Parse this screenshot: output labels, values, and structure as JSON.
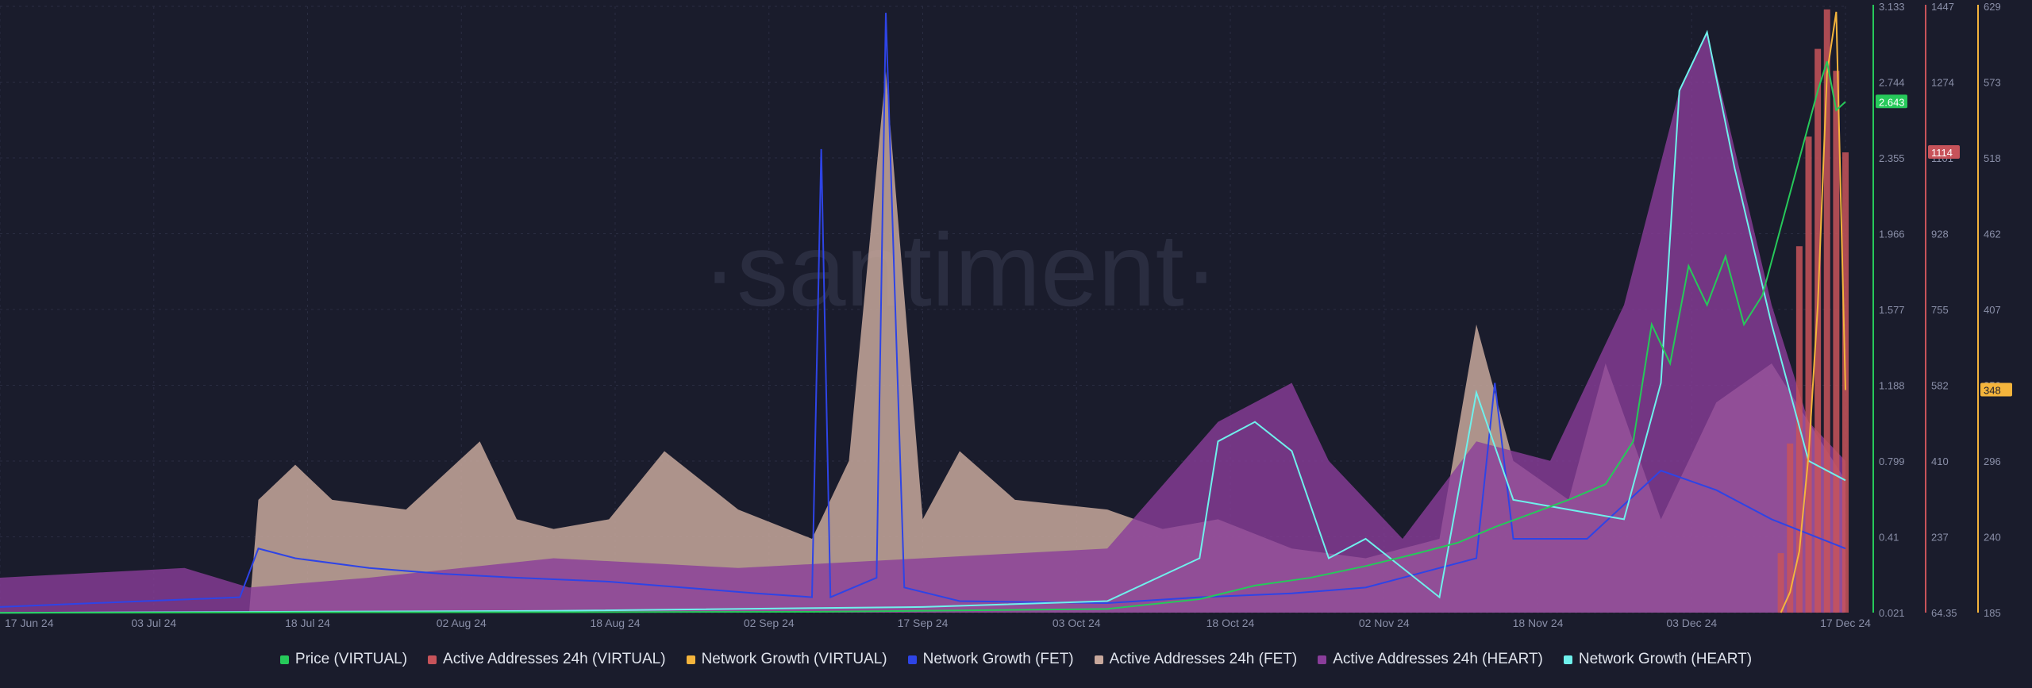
{
  "watermark": "·santiment·",
  "colors": {
    "background": "#1a1c2c",
    "grid": "#2a2d42",
    "tick_text": "#8a8fa8",
    "price_virtual": "#26c95a",
    "aa_virtual": "#c7535a",
    "ng_virtual": "#f4b43c",
    "ng_fet": "#2e44e6",
    "aa_fet": "#c8a89c",
    "aa_heart": "#8a3d9a",
    "ng_heart": "#6ff0ec"
  },
  "chart_data": {
    "type": "line",
    "x_labels": [
      "17 Jun 24",
      "03 Jul 24",
      "18 Jul 24",
      "02 Aug 24",
      "18 Aug 24",
      "02 Sep 24",
      "17 Sep 24",
      "03 Oct 24",
      "18 Oct 24",
      "02 Nov 24",
      "18 Nov 24",
      "03 Dec 24",
      "17 Dec 24"
    ],
    "axes": {
      "price": {
        "ticks": [
          "3.133",
          "2.744",
          "2.355",
          "1.966",
          "1.577",
          "1.188",
          "0.799",
          "0.41",
          "0.021"
        ],
        "range": [
          0.021,
          3.133
        ],
        "current_label": "2.643",
        "current": 2.643
      },
      "aa_virtual": {
        "ticks": [
          "1447",
          "1274",
          "1101",
          "928",
          "755",
          "582",
          "410",
          "237",
          "64.35"
        ],
        "range": [
          64.35,
          1447
        ],
        "current_label": "1114",
        "current": 1114
      },
      "ng_virtual": {
        "ticks": [
          "629",
          "573",
          "518",
          "462",
          "407",
          "352",
          "296",
          "240",
          "185"
        ],
        "range": [
          185,
          629
        ],
        "current_label": "348",
        "current": 348
      }
    },
    "series": [
      {
        "name": "Price (VIRTUAL)",
        "key": "price_virtual",
        "kind": "line",
        "axis": "price",
        "values": [
          [
            0,
            0.02
          ],
          [
            0.44,
            0.025
          ],
          [
            0.6,
            0.04
          ],
          [
            0.65,
            0.09
          ],
          [
            0.68,
            0.16
          ],
          [
            0.71,
            0.2
          ],
          [
            0.74,
            0.26
          ],
          [
            0.77,
            0.33
          ],
          [
            0.79,
            0.38
          ],
          [
            0.81,
            0.46
          ],
          [
            0.83,
            0.53
          ],
          [
            0.85,
            0.6
          ],
          [
            0.87,
            0.68
          ],
          [
            0.885,
            0.9
          ],
          [
            0.895,
            1.5
          ],
          [
            0.905,
            1.3
          ],
          [
            0.915,
            1.8
          ],
          [
            0.925,
            1.6
          ],
          [
            0.935,
            1.85
          ],
          [
            0.945,
            1.5
          ],
          [
            0.955,
            1.65
          ],
          [
            0.965,
            2.0
          ],
          [
            0.975,
            2.35
          ],
          [
            0.985,
            2.7
          ],
          [
            0.99,
            2.85
          ],
          [
            0.995,
            2.6
          ],
          [
            1.0,
            2.643
          ]
        ]
      },
      {
        "name": "Active Addresses 24h (VIRTUAL)",
        "key": "aa_virtual",
        "kind": "bar",
        "axis": "aa_virtual",
        "values": [
          [
            0.965,
            200
          ],
          [
            0.97,
            450
          ],
          [
            0.975,
            900
          ],
          [
            0.98,
            1150
          ],
          [
            0.985,
            1350
          ],
          [
            0.99,
            1440
          ],
          [
            0.995,
            1300
          ],
          [
            1.0,
            1114
          ]
        ]
      },
      {
        "name": "Network Growth (VIRTUAL)",
        "key": "ng_virtual",
        "kind": "line",
        "axis": "ng_virtual",
        "values": [
          [
            0.965,
            185
          ],
          [
            0.97,
            200
          ],
          [
            0.975,
            230
          ],
          [
            0.98,
            300
          ],
          [
            0.985,
            410
          ],
          [
            0.99,
            580
          ],
          [
            0.995,
            625
          ],
          [
            1.0,
            348
          ]
        ]
      },
      {
        "name": "Network Growth (FET)",
        "key": "ng_fet",
        "kind": "line",
        "axis": "price",
        "values": [
          [
            0,
            0.05
          ],
          [
            0.13,
            0.1
          ],
          [
            0.14,
            0.35
          ],
          [
            0.16,
            0.3
          ],
          [
            0.2,
            0.25
          ],
          [
            0.24,
            0.22
          ],
          [
            0.28,
            0.2
          ],
          [
            0.33,
            0.18
          ],
          [
            0.37,
            0.15
          ],
          [
            0.41,
            0.12
          ],
          [
            0.44,
            0.1
          ],
          [
            0.445,
            2.4
          ],
          [
            0.45,
            0.1
          ],
          [
            0.475,
            0.2
          ],
          [
            0.48,
            3.1
          ],
          [
            0.49,
            0.15
          ],
          [
            0.52,
            0.08
          ],
          [
            0.6,
            0.07
          ],
          [
            0.65,
            0.1
          ],
          [
            0.7,
            0.12
          ],
          [
            0.74,
            0.15
          ],
          [
            0.8,
            0.3
          ],
          [
            0.81,
            1.2
          ],
          [
            0.82,
            0.4
          ],
          [
            0.86,
            0.4
          ],
          [
            0.9,
            0.75
          ],
          [
            0.93,
            0.65
          ],
          [
            0.96,
            0.5
          ],
          [
            1.0,
            0.35
          ]
        ]
      },
      {
        "name": "Active Addresses 24h (FET)",
        "key": "aa_fet",
        "kind": "area",
        "axis": "price",
        "values": [
          [
            0,
            0.02
          ],
          [
            0.135,
            0.02
          ],
          [
            0.14,
            0.6
          ],
          [
            0.16,
            0.78
          ],
          [
            0.18,
            0.6
          ],
          [
            0.22,
            0.55
          ],
          [
            0.26,
            0.9
          ],
          [
            0.28,
            0.5
          ],
          [
            0.3,
            0.45
          ],
          [
            0.33,
            0.5
          ],
          [
            0.36,
            0.85
          ],
          [
            0.4,
            0.55
          ],
          [
            0.44,
            0.4
          ],
          [
            0.46,
            0.8
          ],
          [
            0.48,
            2.8
          ],
          [
            0.5,
            0.5
          ],
          [
            0.52,
            0.85
          ],
          [
            0.55,
            0.6
          ],
          [
            0.6,
            0.55
          ],
          [
            0.63,
            0.45
          ],
          [
            0.66,
            0.5
          ],
          [
            0.7,
            0.35
          ],
          [
            0.74,
            0.3
          ],
          [
            0.78,
            0.4
          ],
          [
            0.8,
            1.5
          ],
          [
            0.82,
            0.8
          ],
          [
            0.85,
            0.6
          ],
          [
            0.87,
            1.3
          ],
          [
            0.9,
            0.5
          ],
          [
            0.93,
            1.1
          ],
          [
            0.96,
            1.3
          ],
          [
            0.98,
            1.0
          ],
          [
            1.0,
            0.7
          ]
        ]
      },
      {
        "name": "Active Addresses 24h (HEART)",
        "key": "aa_heart",
        "kind": "area",
        "axis": "price",
        "values": [
          [
            0,
            0.2
          ],
          [
            0.1,
            0.25
          ],
          [
            0.135,
            0.15
          ],
          [
            0.2,
            0.2
          ],
          [
            0.3,
            0.3
          ],
          [
            0.4,
            0.25
          ],
          [
            0.5,
            0.3
          ],
          [
            0.6,
            0.35
          ],
          [
            0.66,
            1.0
          ],
          [
            0.7,
            1.2
          ],
          [
            0.72,
            0.8
          ],
          [
            0.76,
            0.4
          ],
          [
            0.8,
            0.9
          ],
          [
            0.84,
            0.8
          ],
          [
            0.88,
            1.6
          ],
          [
            0.91,
            2.7
          ],
          [
            0.925,
            3.0
          ],
          [
            0.94,
            2.4
          ],
          [
            0.96,
            1.6
          ],
          [
            0.98,
            1.0
          ],
          [
            1.0,
            0.8
          ]
        ]
      },
      {
        "name": "Network Growth (HEART)",
        "key": "ng_heart",
        "kind": "line",
        "axis": "price",
        "values": [
          [
            0,
            0.02
          ],
          [
            0.3,
            0.03
          ],
          [
            0.5,
            0.05
          ],
          [
            0.6,
            0.08
          ],
          [
            0.65,
            0.3
          ],
          [
            0.66,
            0.9
          ],
          [
            0.68,
            1.0
          ],
          [
            0.7,
            0.85
          ],
          [
            0.72,
            0.3
          ],
          [
            0.74,
            0.4
          ],
          [
            0.78,
            0.1
          ],
          [
            0.8,
            1.15
          ],
          [
            0.82,
            0.6
          ],
          [
            0.85,
            0.55
          ],
          [
            0.88,
            0.5
          ],
          [
            0.9,
            1.2
          ],
          [
            0.91,
            2.7
          ],
          [
            0.925,
            3.0
          ],
          [
            0.94,
            2.3
          ],
          [
            0.96,
            1.5
          ],
          [
            0.98,
            0.8
          ],
          [
            1.0,
            0.7
          ]
        ]
      }
    ]
  }
}
